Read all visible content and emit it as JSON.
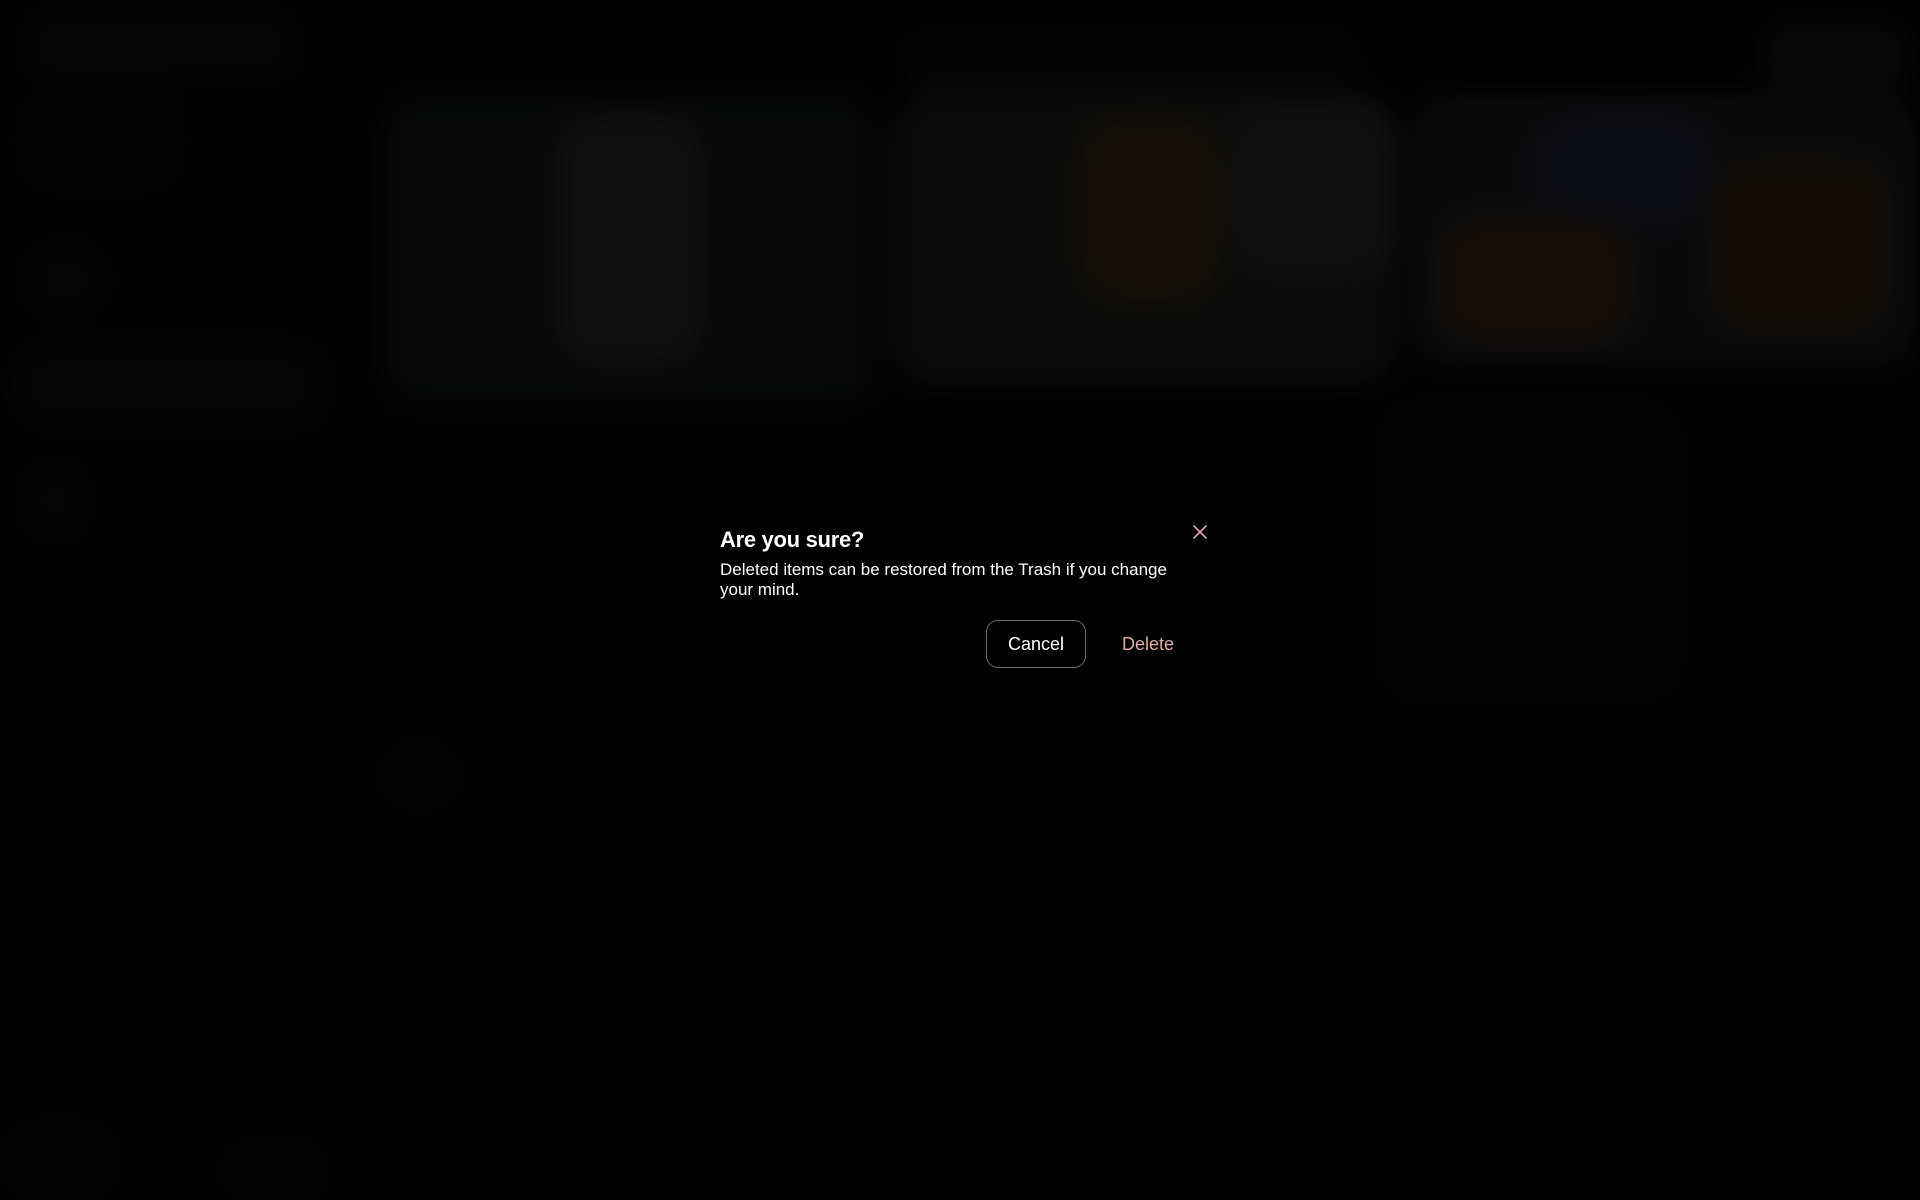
{
  "dialog": {
    "title": "Are you sure?",
    "message": "Deleted items can be restored from the Trash if you change your mind.",
    "cancel_label": "Cancel",
    "delete_label": "Delete",
    "close_icon": "close-icon"
  },
  "colors": {
    "background": "#000000",
    "text": "#ffffff",
    "destructive": "#e2aaa1",
    "button_border": "#6a6a6a"
  }
}
